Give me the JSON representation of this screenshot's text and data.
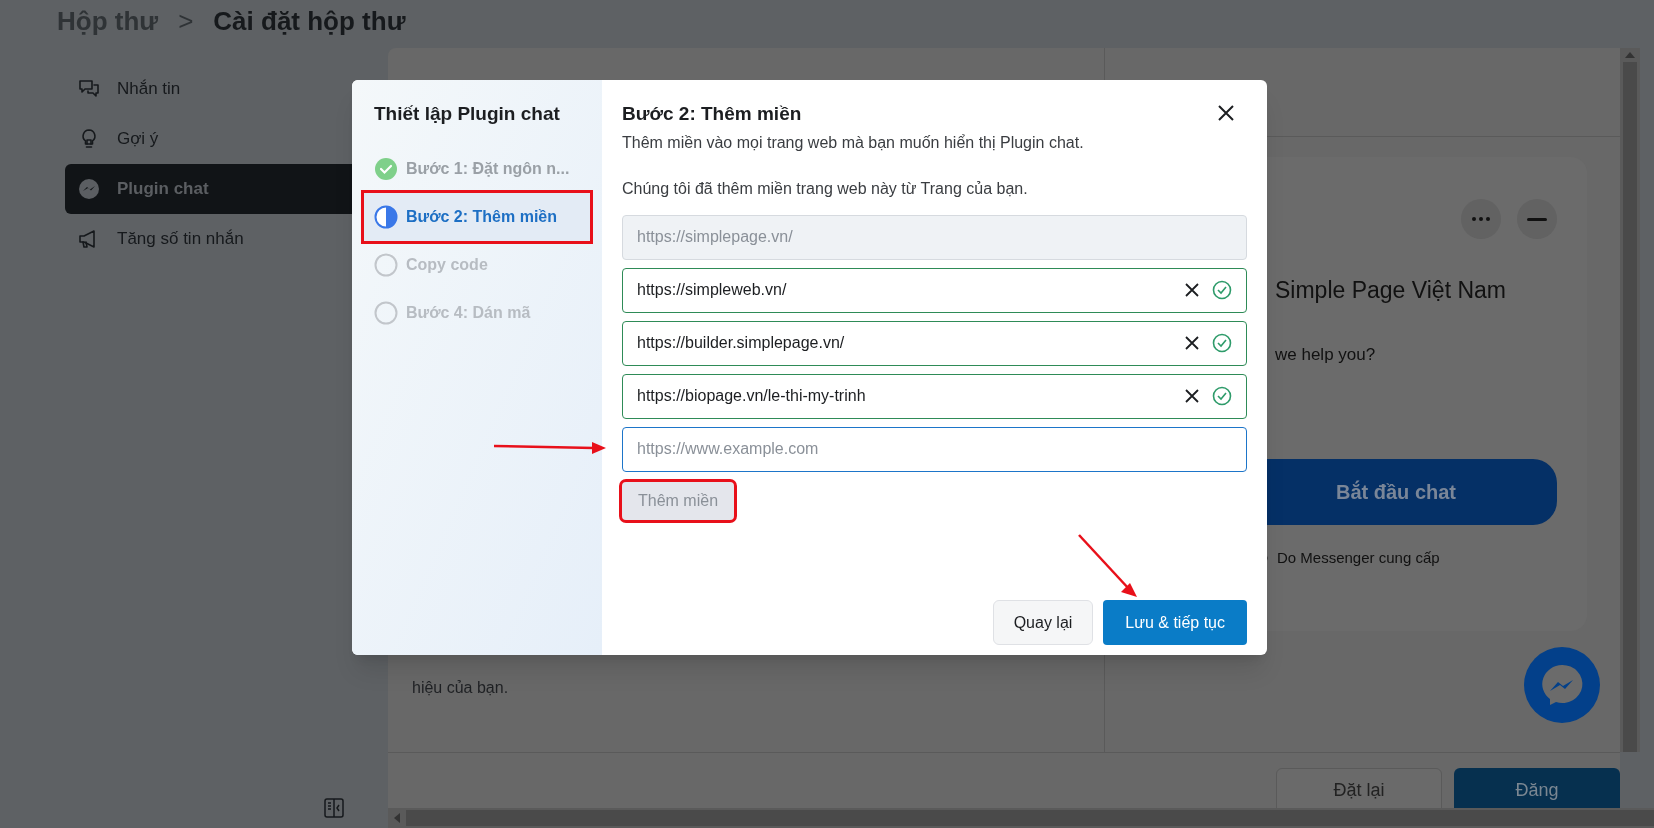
{
  "breadcrumb": {
    "parent": "Hộp thư",
    "separator": ">",
    "current": "Cài đặt hộp thư"
  },
  "sidebar": {
    "items": [
      {
        "label": "Nhắn tin",
        "kind": "chat",
        "selected": false
      },
      {
        "label": "Gợi ý",
        "kind": "bulb",
        "selected": false
      },
      {
        "label": "Plugin chat",
        "kind": "messenger",
        "selected": true
      },
      {
        "label": "Tăng số tin nhắn",
        "kind": "megaphone",
        "selected": false
      }
    ]
  },
  "main_panel": {
    "text": "hiệu của bạn."
  },
  "preview": {
    "page_name": "Simple Page Việt Nam",
    "greeting": "we help you?",
    "start_button": "Bắt đầu chat",
    "powered_by": "Do Messenger cung cấp"
  },
  "footer": {
    "buttons": [
      {
        "label": "Đặt lại",
        "kind": "secondary"
      },
      {
        "label": "Đăng",
        "kind": "primary"
      }
    ]
  },
  "modal": {
    "title": "Thiết lập Plugin chat",
    "steps": [
      {
        "label": "Bước 1: Đặt ngôn n...",
        "kind": "done",
        "selected": false
      },
      {
        "label": "Bước 2: Thêm miền",
        "kind": "current",
        "selected": true
      },
      {
        "label": "Copy code",
        "kind": "todo",
        "selected": false
      },
      {
        "label": "Bước 4: Dán mã",
        "kind": "todo",
        "selected": false
      }
    ],
    "heading": "Bước 2: Thêm miền",
    "subtitle": "Thêm miền vào mọi trang web mà bạn muốn hiển thị Plugin chat.",
    "note": "Chúng tôi đã thêm miền trang web này từ Trang của bạn.",
    "domains": [
      {
        "value": "https://simplepage.vn/",
        "kind": "readonly"
      },
      {
        "value": "https://simpleweb.vn/",
        "kind": "verified"
      },
      {
        "value": "https://builder.simplepage.vn/",
        "kind": "verified"
      },
      {
        "value": "https://biopage.vn/le-thi-my-trinh",
        "kind": "verified"
      }
    ],
    "new_domain": {
      "placeholder": "https://www.example.com"
    },
    "add_button": {
      "label": "Thêm miền",
      "disabled": true
    },
    "back_button": "Quay lại",
    "next_button": "Lưu & tiếp tục"
  }
}
